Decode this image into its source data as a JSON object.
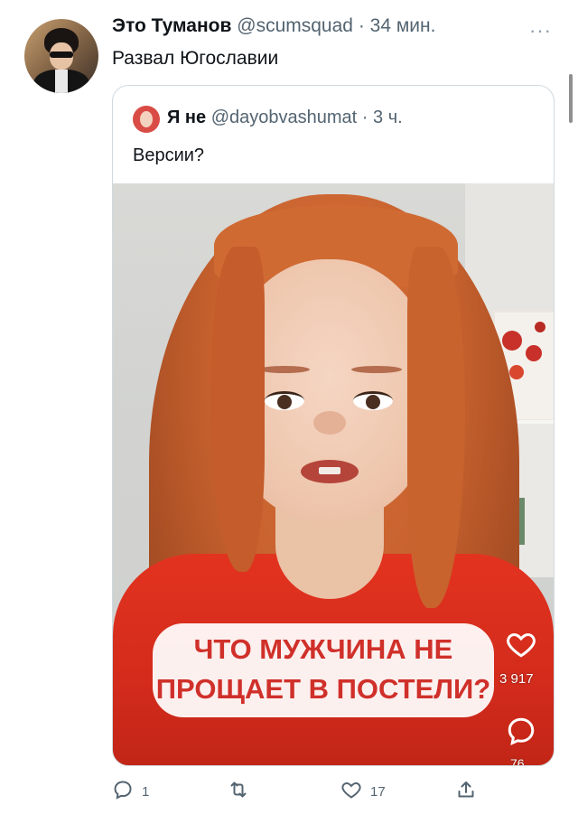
{
  "tweet": {
    "display_name": "Это Туманов",
    "handle": "@scumsquad",
    "separator": "·",
    "time": "34 мин.",
    "more_icon": "more-icon",
    "text": "Развал Югославии"
  },
  "quote": {
    "display_name": "Я не",
    "handle": "@dayobvashumat",
    "separator": "·",
    "time": "3 ч.",
    "text": "Версии?",
    "video": {
      "caption_line1": "ЧТО МУЖЧИНА НЕ",
      "caption_line2": "ПРОЩАЕТ В ПОСТЕЛИ?",
      "likes": "3 917",
      "comments": "76",
      "caption_color": "#d0302a"
    }
  },
  "actions": {
    "reply_count": "1",
    "retweet_count": "",
    "like_count": "17",
    "share_icon": "share-icon"
  },
  "colors": {
    "text": "#0f1419",
    "secondary": "#536471",
    "border": "#cfd9de"
  }
}
